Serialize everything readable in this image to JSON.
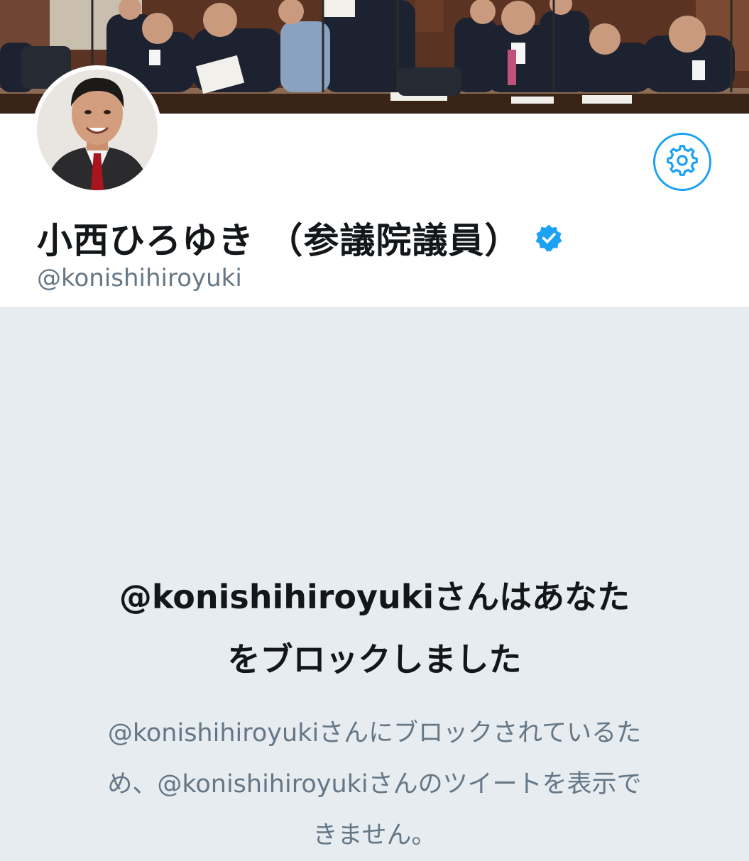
{
  "profile": {
    "display_name": "小西ひろゆき （参議院議員）",
    "screen_name": "@konishihiroyuki",
    "verified": true
  },
  "icons": {
    "settings": "gear-icon",
    "verified": "verified-checkmark-icon"
  },
  "blocked": {
    "title_line1": "@konishihiroyukiさんはあなた",
    "title_line2": "をブロックしました",
    "desc_line1": "@konishihiroyukiさんにブロックされているた",
    "desc_line2": "め、@konishihiroyukiさんのツイートを表示で",
    "desc_line3": "きません。"
  },
  "colors": {
    "accent": "#1da1f2",
    "background": "#e6ecf0",
    "name_text": "#14171a",
    "secondary_text": "#657786"
  }
}
